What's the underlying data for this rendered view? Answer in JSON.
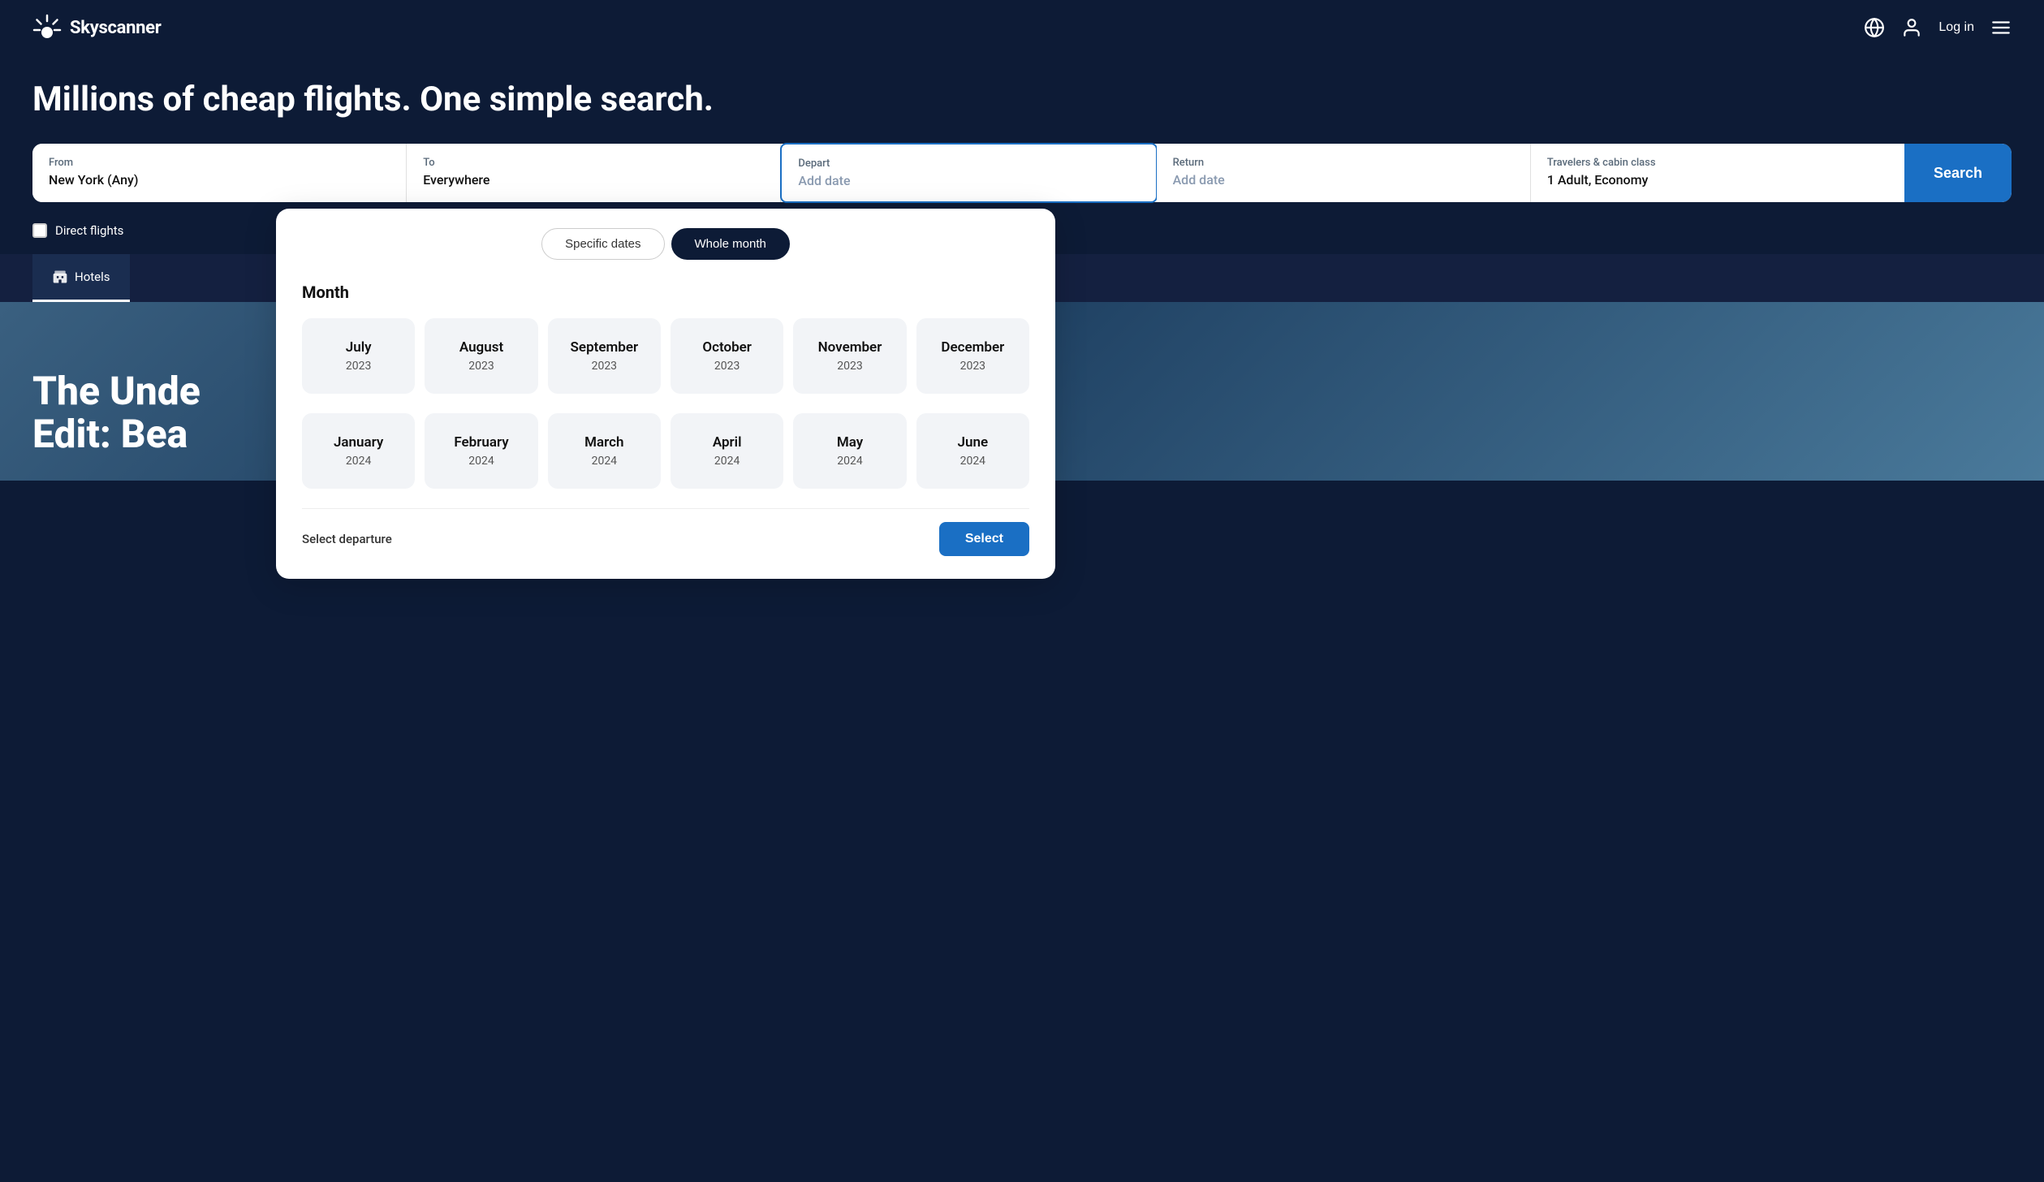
{
  "header": {
    "logo_text": "Skyscanner",
    "login_label": "Log in"
  },
  "hero": {
    "title": "Millions of cheap flights. One simple search."
  },
  "search": {
    "from_label": "From",
    "from_value": "New York (Any)",
    "to_label": "To",
    "to_value": "Everywhere",
    "depart_label": "Depart",
    "depart_placeholder": "Add date",
    "return_label": "Return",
    "return_placeholder": "Add date",
    "travelers_label": "Travelers & cabin class",
    "travelers_value": "1 Adult, Economy",
    "search_button": "Search"
  },
  "direct_flights": {
    "label": "Direct flights"
  },
  "nav_tabs": [
    {
      "id": "hotels",
      "label": "Hotels",
      "icon": "hotel-icon",
      "active": true
    }
  ],
  "bg_text": {
    "line1": "The Unde",
    "line2": "Edit: Bea"
  },
  "date_picker": {
    "toggle_specific": "Specific dates",
    "toggle_whole_month": "Whole month",
    "month_section_label": "Month",
    "months_row1": [
      {
        "name": "July",
        "year": "2023"
      },
      {
        "name": "August",
        "year": "2023"
      },
      {
        "name": "September",
        "year": "2023"
      },
      {
        "name": "October",
        "year": "2023"
      },
      {
        "name": "November",
        "year": "2023"
      },
      {
        "name": "December",
        "year": "2023"
      }
    ],
    "months_row2": [
      {
        "name": "January",
        "year": "2024"
      },
      {
        "name": "February",
        "year": "2024"
      },
      {
        "name": "March",
        "year": "2024"
      },
      {
        "name": "April",
        "year": "2024"
      },
      {
        "name": "May",
        "year": "2024"
      },
      {
        "name": "June",
        "year": "2024"
      }
    ],
    "footer_label": "Select departure",
    "select_button": "Select"
  }
}
